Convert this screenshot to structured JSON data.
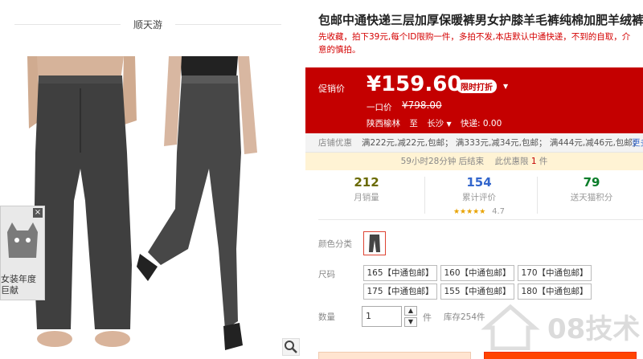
{
  "gallery": {
    "brand_name": "顺天游",
    "ad_text_line1": "女装年度",
    "ad_text_line2": "巨献",
    "close_glyph": "×",
    "zoom_icon": "magnifier-icon"
  },
  "product": {
    "title": "包邮中通快递三层加厚保暖裤男女护膝羊毛裤纯棉加肥羊绒裤",
    "subtitle": "先收藏，拍下39元,每个ID限购一件，多拍不发,本店默认中通快递，不到的自取，介意的慎拍。"
  },
  "price": {
    "label": "促销价",
    "value": "¥159.60",
    "badge": "限时打折",
    "original_label": "一口价",
    "original_value": "¥798.00",
    "ship_from": "陕西榆林",
    "ship_to_prefix": "至",
    "ship_to": "长沙",
    "shipping_fee": "快递: 0.00"
  },
  "promo": {
    "label": "店铺优惠",
    "text": "满222元,减22元,包邮；  满333元,减34元,包邮；  满444元,减46元,包邮；",
    "more": "更多"
  },
  "timer": {
    "remaining": "59小时28分钟",
    "ends": "后结束",
    "limit_text": "此优惠限",
    "limit_count": "1",
    "unit": "件"
  },
  "stats": [
    {
      "value": "212",
      "label": "月销量",
      "color": "#6a6a00"
    },
    {
      "value": "154",
      "label": "累计评价",
      "color": "#3366cc"
    },
    {
      "value": "79",
      "label": "送天猫积分",
      "color": "#0a7d2a"
    }
  ],
  "rating": {
    "stars": "★★★★★",
    "score": "4.7"
  },
  "options": {
    "color_label": "颜色分类",
    "size_label": "尺码",
    "sizes": [
      "165【中通包邮】",
      "160【中通包邮】",
      "170【中通包邮】",
      "175【中通包邮】",
      "155【中通包邮】",
      "180【中通包邮】"
    ]
  },
  "quantity": {
    "label": "数量",
    "value": "1",
    "unit": "件",
    "stock": "库存254件"
  },
  "watermark": {
    "text": "08技术"
  },
  "colors": {
    "accent_red": "#c40000",
    "promo_bg": "#fff3d4"
  }
}
